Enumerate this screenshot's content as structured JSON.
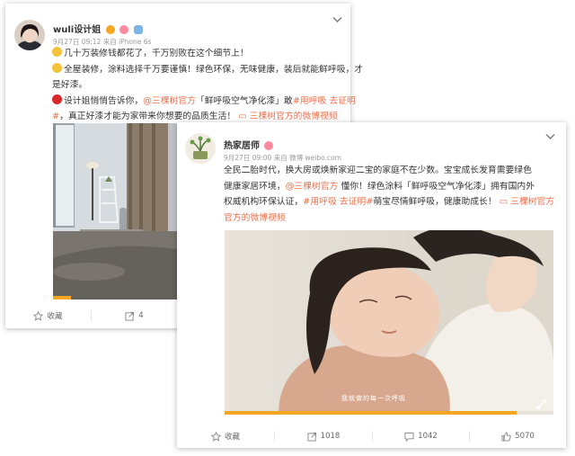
{
  "post1": {
    "username": "wuli设计姐",
    "timestamp": "9月27日 09:12",
    "source": "来自 iPhone 6s",
    "lines": {
      "l1": "几十万装修钱都花了，千万别败在这个细节上！",
      "l2": "全屋装修，涂料选择千万要谨慎！绿色环保，无味健康，装后就能鲜呼吸，才",
      "l3": "是好漆。",
      "l4a": "设计姐悄悄告诉你，",
      "l4b": "@三棵树官方",
      "l4c": "「鲜呼吸空气净化漆」",
      "l4d": "敢",
      "l4e": "#用呼吸 去证明",
      "l5a": "#",
      "l5b": "，真正好漆才能为家带来你想要的品质生活！",
      "l5c": "三棵树官方的微博视频"
    },
    "actions": {
      "favorite": "收藏",
      "forward": "4"
    }
  },
  "post2": {
    "username": "热家居师",
    "timestamp": "9月27日 09:00",
    "source": "来自 微博 weibo.com",
    "lines": {
      "l1": "全民二胎时代，换大房或焕新家迎二宝的家庭不在少数。宝宝成长发育需要绿色",
      "l2a": "健康家居环境，",
      "l2b": "@三棵树官方",
      "l2c": " 懂你！绿色涂料「鲜呼吸空气净化漆」拥有国内外",
      "l3a": "权威机构环保认证，",
      "l3b": "#用呼吸 去证明#",
      "l3c": "萌宝尽情鲜呼吸，健康助成长！",
      "l3d": "三棵树官方",
      "l4": "官方的微博视频"
    },
    "video_caption": "我就做的每一次呼吸",
    "actions": {
      "favorite": "收藏",
      "forward": "1018",
      "comment": "1042",
      "like": "5070"
    }
  },
  "colors": {
    "link": "#eb7350",
    "text": "#333333",
    "meta": "#999999"
  }
}
